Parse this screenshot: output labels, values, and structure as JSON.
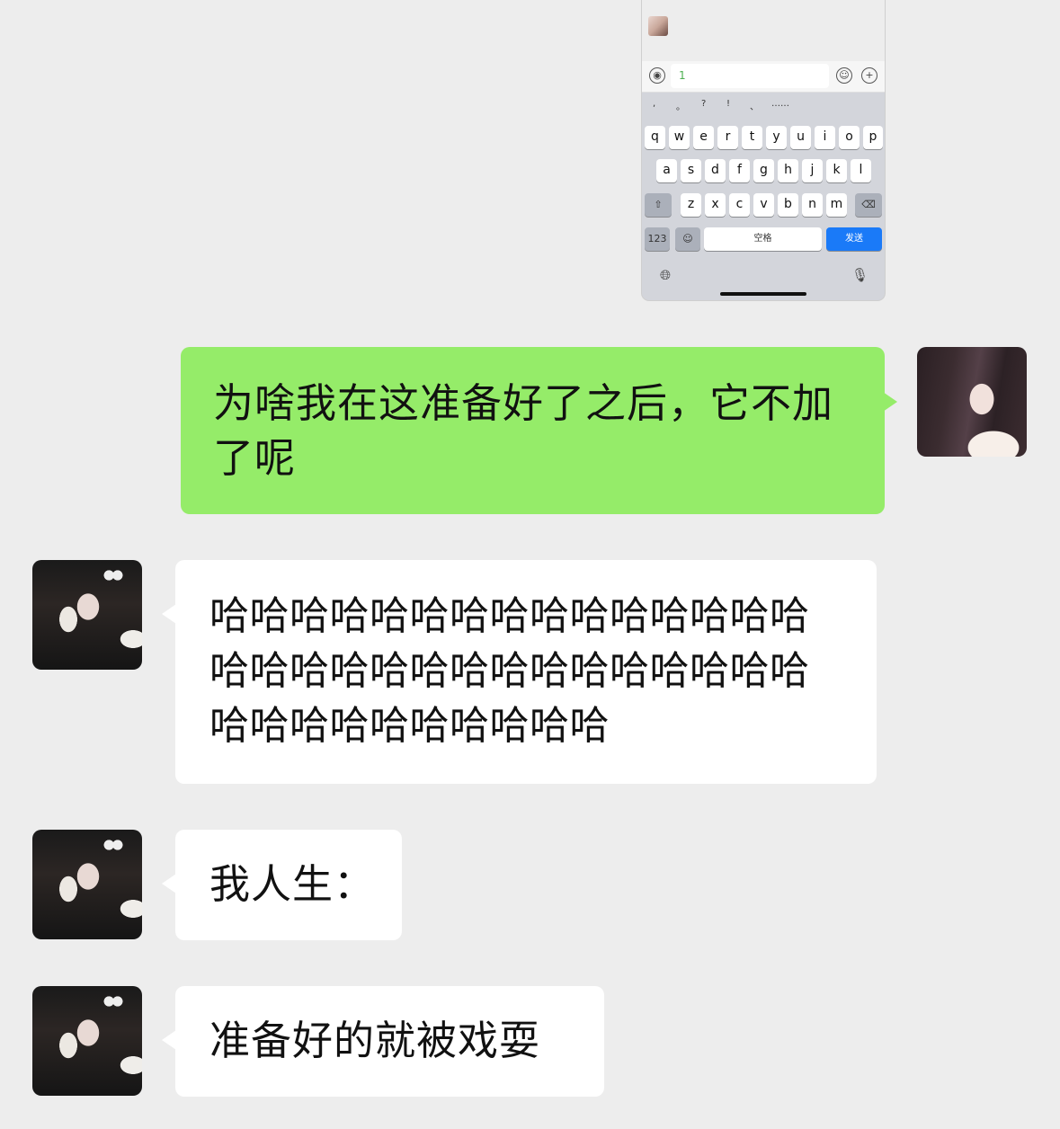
{
  "keyboard_screenshot": {
    "input_text": "1",
    "punctuation": [
      ",",
      "。",
      "?",
      "!",
      "、",
      "……"
    ],
    "row1": [
      "q",
      "w",
      "e",
      "r",
      "t",
      "y",
      "u",
      "i",
      "o",
      "p"
    ],
    "row2": [
      "a",
      "s",
      "d",
      "f",
      "g",
      "h",
      "j",
      "k",
      "l"
    ],
    "row3": [
      "z",
      "x",
      "c",
      "v",
      "b",
      "n",
      "m"
    ],
    "numbers_key": "123",
    "space_key": "空格",
    "send_key": "发送"
  },
  "messages": [
    {
      "side": "right",
      "text": "为啥我在这准备好了之后，它不加了呢"
    },
    {
      "side": "left",
      "text": "哈哈哈哈哈哈哈哈哈哈哈哈哈哈哈哈哈哈哈哈哈哈哈哈哈哈哈哈哈哈哈哈哈哈哈哈哈哈哈哈"
    },
    {
      "side": "left",
      "text": "我人生："
    },
    {
      "side": "left",
      "text": "准备好的就被戏耍"
    }
  ]
}
